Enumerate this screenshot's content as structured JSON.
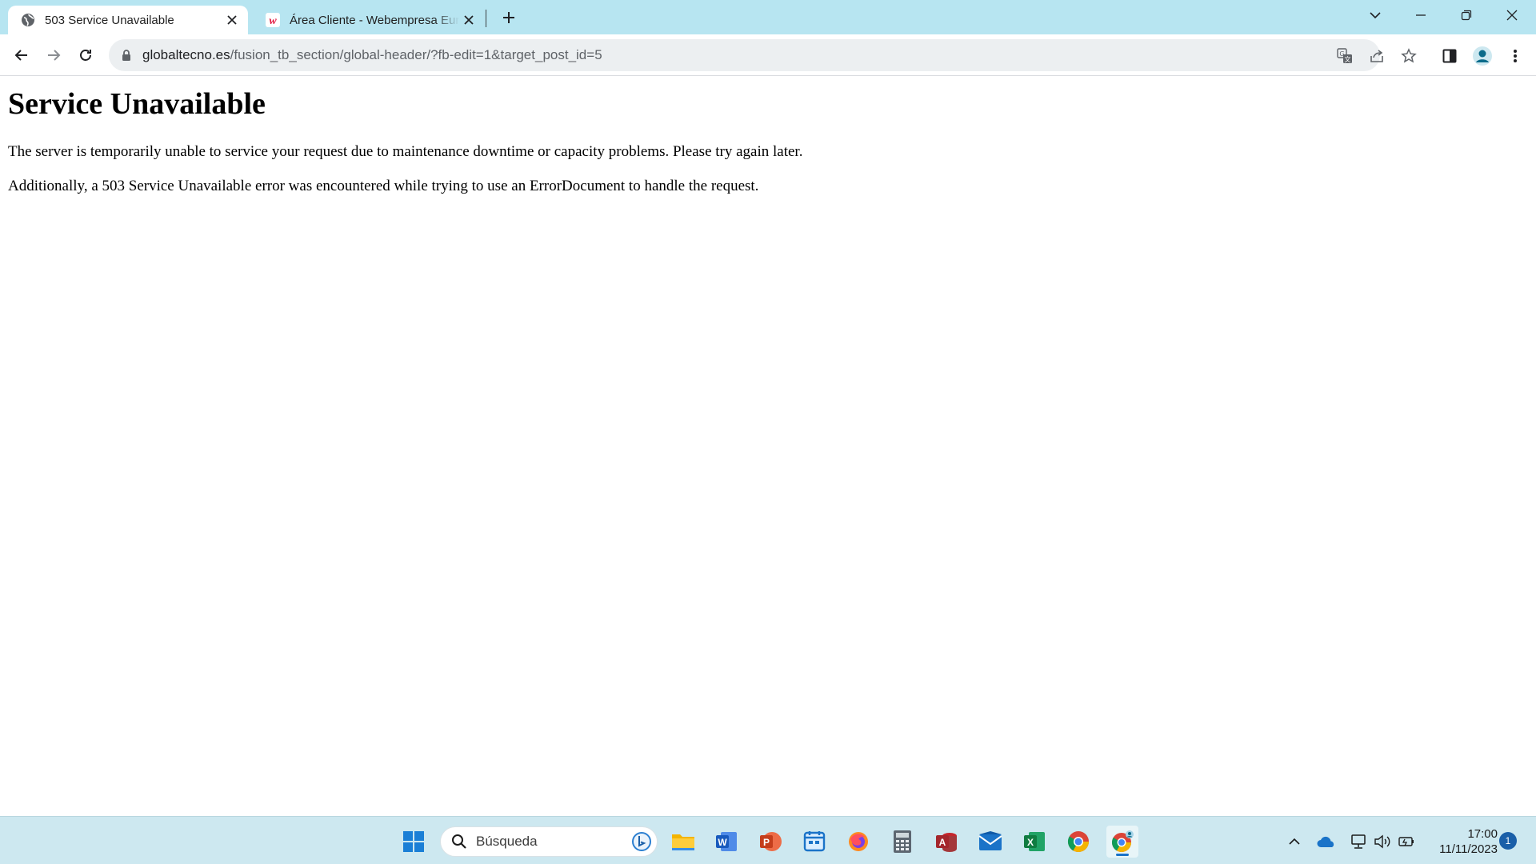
{
  "browser": {
    "tabs": [
      {
        "title": "503 Service Unavailable",
        "active": true,
        "favicon": "globe-icon"
      },
      {
        "title": "Área Cliente - Webempresa Europa",
        "active": false,
        "favicon": "webempresa-logo-icon"
      }
    ],
    "url": {
      "host": "globaltecno.es",
      "path": "/fusion_tb_section/global-header/?fb-edit=1&target_post_id=5"
    },
    "colors": {
      "tabstrip": "#b7e5f1",
      "omnibox": "#eceff1"
    }
  },
  "page": {
    "heading": "Service Unavailable",
    "paragraphs": [
      "The server is temporarily unable to service your request due to maintenance downtime or capacity problems. Please try again later.",
      "Additionally, a 503 Service Unavailable error was encountered while trying to use an ErrorDocument to handle the request."
    ]
  },
  "taskbar": {
    "search_placeholder": "Búsqueda",
    "apps": [
      "windows-start-icon",
      "file-explorer-icon",
      "word-icon",
      "powerpoint-icon",
      "outlook-calendar-icon",
      "firefox-icon",
      "calculator-icon",
      "access-icon",
      "mail-icon",
      "excel-icon",
      "chrome-icon",
      "chrome-profile-icon"
    ],
    "clock": {
      "time": "17:00",
      "date": "11/11/2023"
    },
    "notification_count": "1"
  }
}
